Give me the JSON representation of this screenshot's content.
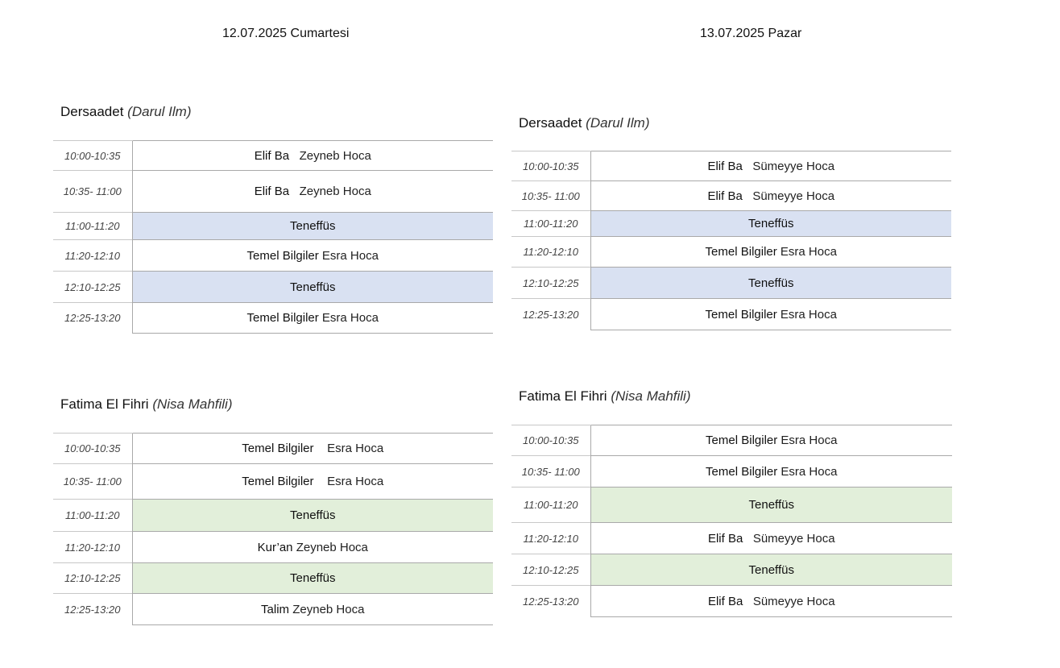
{
  "days": [
    {
      "title": "12.07.2025 Cumartesi",
      "sections": [
        {
          "name": "Dersaadet",
          "sub": "(Darul Ilm)",
          "rows": [
            {
              "time": "10:00-10:35",
              "lesson": "Elif Ba",
              "gap": "   ",
              "teacher": "Zeyneb Hoca",
              "type": "class"
            },
            {
              "time": "10:35- 11:00",
              "lesson": "Elif Ba",
              "gap": "   ",
              "teacher": "Zeyneb Hoca",
              "type": "class"
            },
            {
              "time": "11:00-11:20",
              "lesson": "Teneffüs",
              "gap": "",
              "teacher": "",
              "type": "break"
            },
            {
              "time": "11:20-12:10",
              "lesson": "Temel Bilgiler",
              "gap": " ",
              "teacher": "Esra Hoca",
              "type": "class"
            },
            {
              "time": "12:10-12:25",
              "lesson": "Teneffüs",
              "gap": "",
              "teacher": "",
              "type": "break"
            },
            {
              "time": "12:25-13:20",
              "lesson": "Temel Bilgiler",
              "gap": " ",
              "teacher": "Esra Hoca",
              "type": "class"
            }
          ]
        },
        {
          "name": "Fatima El Fihri",
          "sub": "(Nisa Mahfili)",
          "rows": [
            {
              "time": "10:00-10:35",
              "lesson": "Temel Bilgiler",
              "gap": "    ",
              "teacher": "Esra Hoca",
              "type": "class"
            },
            {
              "time": "10:35- 11:00",
              "lesson": "Temel Bilgiler",
              "gap": "    ",
              "teacher": "Esra Hoca",
              "type": "class"
            },
            {
              "time": "11:00-11:20",
              "lesson": "Teneffüs",
              "gap": "",
              "teacher": "",
              "type": "break"
            },
            {
              "time": "11:20-12:10",
              "lesson": "Kur’an",
              "gap": " ",
              "teacher": "Zeyneb Hoca",
              "type": "class"
            },
            {
              "time": "12:10-12:25",
              "lesson": "Teneffüs",
              "gap": "",
              "teacher": "",
              "type": "break"
            },
            {
              "time": "12:25-13:20",
              "lesson": "Talim",
              "gap": " ",
              "teacher": "Zeyneb Hoca",
              "type": "class"
            }
          ]
        }
      ]
    },
    {
      "title": "13.07.2025 Pazar",
      "sections": [
        {
          "name": "Dersaadet",
          "sub": "(Darul Ilm)",
          "rows": [
            {
              "time": "10:00-10:35",
              "lesson": "Elif Ba",
              "gap": "   ",
              "teacher": "Sümeyye Hoca",
              "type": "class"
            },
            {
              "time": "10:35- 11:00",
              "lesson": "Elif Ba",
              "gap": "   ",
              "teacher": "Sümeyye Hoca",
              "type": "class"
            },
            {
              "time": "11:00-11:20",
              "lesson": "Teneffüs",
              "gap": "",
              "teacher": "",
              "type": "break"
            },
            {
              "time": "11:20-12:10",
              "lesson": "Temel Bilgiler",
              "gap": " ",
              "teacher": "Esra Hoca",
              "type": "class"
            },
            {
              "time": "12:10-12:25",
              "lesson": "Teneffüs",
              "gap": "",
              "teacher": "",
              "type": "break"
            },
            {
              "time": "12:25-13:20",
              "lesson": "Temel Bilgiler",
              "gap": " ",
              "teacher": "Esra Hoca",
              "type": "class"
            }
          ]
        },
        {
          "name": "Fatima El Fihri",
          "sub": "(Nisa Mahfili)",
          "rows": [
            {
              "time": "10:00-10:35",
              "lesson": "Temel Bilgiler",
              "gap": " ",
              "teacher": "Esra Hoca",
              "type": "class"
            },
            {
              "time": "10:35- 11:00",
              "lesson": "Temel Bilgiler",
              "gap": " ",
              "teacher": "Esra Hoca",
              "type": "class"
            },
            {
              "time": "11:00-11:20",
              "lesson": "Teneffüs",
              "gap": "",
              "teacher": "",
              "type": "break"
            },
            {
              "time": "11:20-12:10",
              "lesson": "Elif Ba",
              "gap": "   ",
              "teacher": "Sümeyye Hoca",
              "type": "class"
            },
            {
              "time": "12:10-12:25",
              "lesson": "Teneffüs",
              "gap": "",
              "teacher": "",
              "type": "break"
            },
            {
              "time": "12:25-13:20",
              "lesson": "Elif Ba",
              "gap": "   ",
              "teacher": "Sümeyye Hoca",
              "type": "class"
            }
          ]
        }
      ]
    }
  ],
  "colors": {
    "dersaadet_break": "#d9e1f2",
    "fatima_break": "#e2efda",
    "grid_line": "#a9a9a9"
  }
}
